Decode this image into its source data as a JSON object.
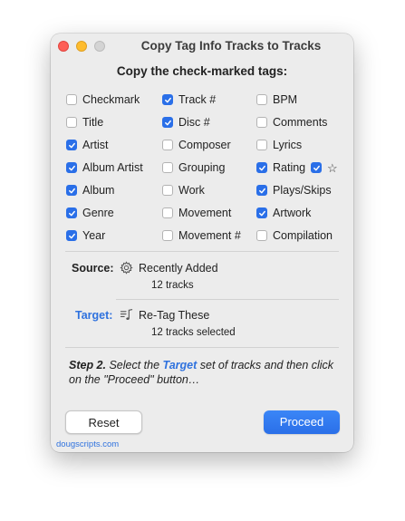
{
  "window": {
    "title": "Copy Tag Info Tracks to Tracks",
    "heading": "Copy the check-marked tags:"
  },
  "tags": [
    {
      "label": "Checkmark",
      "checked": false
    },
    {
      "label": "Track #",
      "checked": true
    },
    {
      "label": "BPM",
      "checked": false
    },
    {
      "label": "Title",
      "checked": false
    },
    {
      "label": "Disc #",
      "checked": true
    },
    {
      "label": "Comments",
      "checked": false
    },
    {
      "label": "Artist",
      "checked": true
    },
    {
      "label": "Composer",
      "checked": false
    },
    {
      "label": "Lyrics",
      "checked": false
    },
    {
      "label": "Album Artist",
      "checked": true
    },
    {
      "label": "Grouping",
      "checked": false
    },
    {
      "label": "Rating",
      "checked": true
    },
    {
      "label": "Album",
      "checked": true
    },
    {
      "label": "Work",
      "checked": false
    },
    {
      "label": "Plays/Skips",
      "checked": true
    },
    {
      "label": "Genre",
      "checked": true
    },
    {
      "label": "Movement",
      "checked": false
    },
    {
      "label": "Artwork",
      "checked": true
    },
    {
      "label": "Year",
      "checked": true
    },
    {
      "label": "Movement #",
      "checked": false
    },
    {
      "label": "Compilation",
      "checked": false
    }
  ],
  "rating_extra": {
    "checked": true,
    "icon": "star-outline-icon",
    "glyph": "☆"
  },
  "source": {
    "label": "Source:",
    "icon": "gear-icon",
    "name": "Recently Added",
    "count": "12 tracks"
  },
  "target": {
    "label": "Target:",
    "icon": "playlist-music-icon",
    "name": "Re-Tag These",
    "count": "12 tracks selected"
  },
  "instructions": {
    "step": "Step 2.",
    "before": " Select the ",
    "target_word": "Target",
    "after": " set of tracks and then click on the \"Proceed\" button…"
  },
  "buttons": {
    "reset": "Reset",
    "proceed": "Proceed"
  },
  "footer": "dougscripts.com",
  "colors": {
    "accent": "#2a6fe8",
    "link": "#2f72de"
  }
}
